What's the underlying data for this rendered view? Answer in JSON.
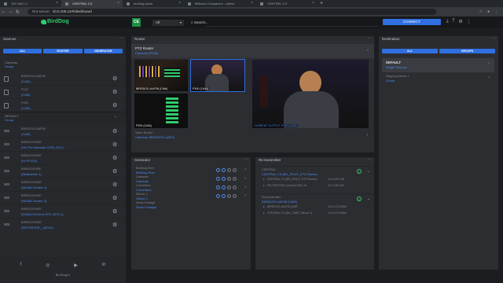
{
  "browser": {
    "tabs": [
      {
        "label": "192.168.1.1",
        "active": false
      },
      {
        "label": "CENTRAL 2.0",
        "active": true
      },
      {
        "label": "birddog-ptzas",
        "active": false
      },
      {
        "label": "Bitfocus Companion - Admin",
        "active": false
      },
      {
        "label": "CENTRAL 2.0",
        "active": false
      }
    ],
    "security_label": "Not secure",
    "url": "10.0.105.12/#/dashboard"
  },
  "app": {
    "logo": "BirdDog",
    "ce_badge": "CE",
    "filter_value": "All",
    "search_label": "Search...",
    "connect_label": "CONNECT"
  },
  "sources": {
    "title": "Sources",
    "buttons": [
      "ALL",
      "ROUTER",
      "GENERATOR"
    ],
    "group_label": "Cameras",
    "group_value": "Group",
    "cam_items": [
      {
        "icon": "cam",
        "name": "BIRDDOG-AAF38",
        "tag": "(CAM)"
      },
      {
        "icon": "cam",
        "name": "P100",
        "tag": "(CAM)"
      },
      {
        "icon": "cam",
        "name": "P200",
        "tag": "(CAM)"
      }
    ],
    "default_label": "DEFAULT",
    "default_value": "Group",
    "ndi_items": [
      {
        "icon": "NDI",
        "name": "BIRDDOG-AAF38",
        "tag": "(CAM)"
      },
      {
        "icon": "NDI",
        "name": "BIRDDOGHEE",
        "tag": "(HD Pro Webcam C920_3317)"
      },
      {
        "icon": "NDI",
        "name": "BIRDDOGHEE",
        "tag": "(Im PF120)"
      },
      {
        "icon": "NDI",
        "name": "BIRDDOGHEE",
        "tag": "(Multiviewer 1)"
      },
      {
        "icon": "NDI",
        "name": "BIRDDOGHEE",
        "tag": "(NDIAR Sender 1)"
      },
      {
        "icon": "NDI",
        "name": "BIRDDOGHEE",
        "tag": "(NDIAR Sender 3)"
      },
      {
        "icon": "NDI",
        "name": "BIRDDOGHEE",
        "tag": "NVIDIA GeForce RTX 2070 1)"
      },
      {
        "icon": "NDI",
        "name": "BIRDDOGHEE",
        "tag": "(REPORTER__0004X)"
      }
    ],
    "footer_brand": "BirdDog.tv"
  },
  "router": {
    "title": "Router",
    "name": "PTZ Router",
    "sub": "Cameras (P100)",
    "cams": [
      {
        "label": "BIRDDOG-AAF38 (CAM)"
      },
      {
        "label": "P100 (CAM)"
      },
      {
        "label": "P200 (CAM)"
      }
    ],
    "current_output": "CURRENT OUTPUT: P100 (CAM)",
    "video_router_label": "Video Router",
    "video_router_value": "Cameras (BIRDDOG-AAF3)"
  },
  "generator": {
    "title": "Generator",
    "rows": [
      {
        "a": "BirdDog Reel",
        "b": "BirdDog Reel"
      },
      {
        "a": "Cameras",
        "b": "Cameras"
      },
      {
        "a": "Converters",
        "b": "Converters"
      },
      {
        "a": "Silicon 1",
        "b": "Silicon 1"
      },
      {
        "a": "Stock Footage",
        "b": "Stock Footage"
      }
    ]
  },
  "retransmitter": {
    "title": "Re-transmitter",
    "groups": [
      {
        "label": "CENTRAL",
        "value": "CENTRAL 2.0 (BG_ROUT_PTZ Router)",
        "subs": [
          {
            "name": "CENTRAL 2.0 (BG_ROUT_PTZ Router)",
            "ip": "10.0.105.156"
          },
          {
            "name": "PM-CENTRAL (Send to BG) 1A",
            "ip": "10.0.105.101"
          }
        ]
      },
      {
        "label": "Re-transmitter",
        "value": "BIRDDOG-AAF38 (CAM)",
        "subs": [
          {
            "name": "BIRDDOG-AAF38 (LWR",
            "ip": "10.0.0.21:5960"
          },
          {
            "name": "CENTRAL 2.0 (BG_OWE_Silicon 1)",
            "ip": "10.0.0.21:5960"
          }
        ]
      }
    ]
  },
  "destination": {
    "title": "Destination",
    "buttons": [
      "ALL",
      "GROUPS"
    ],
    "items": [
      {
        "label": "DEFAULT",
        "value": "Single Sources"
      },
      {
        "label": "Mapping Above 1",
        "value": "Group"
      }
    ]
  }
}
